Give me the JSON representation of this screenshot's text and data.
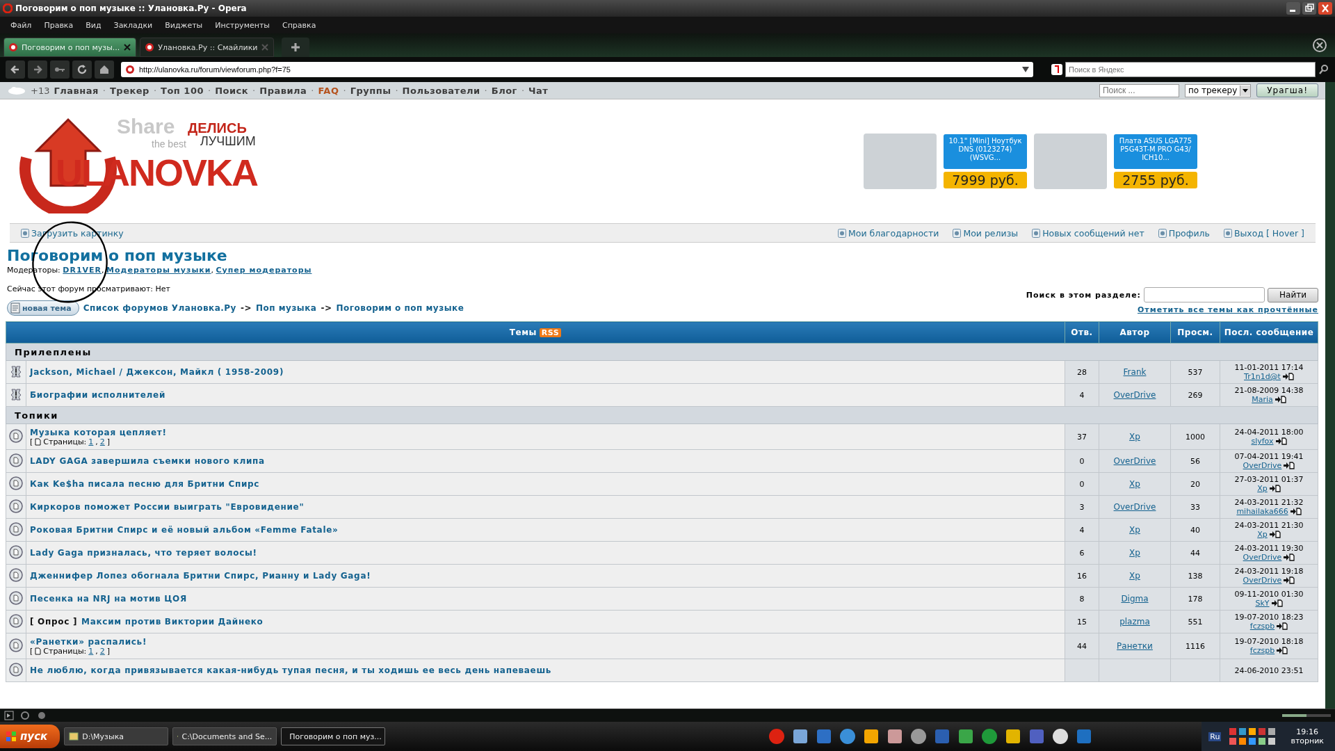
{
  "window": {
    "title": "Поговорим о поп музыке :: Улановка.Ру - Opera"
  },
  "menu": [
    "Файл",
    "Правка",
    "Вид",
    "Закладки",
    "Виджеты",
    "Инструменты",
    "Справка"
  ],
  "tabs": [
    {
      "label": "Поговорим о поп музы...",
      "selected": true
    },
    {
      "label": "Улановка.Ру :: Смайлики",
      "selected": false
    }
  ],
  "address_bar": {
    "url": "http://ulanovka.ru/forum/viewforum.php?f=75"
  },
  "web_search": {
    "placeholder": "Поиск в Яндекс"
  },
  "site_nav": {
    "counter": "+13",
    "separator": "·",
    "links": [
      {
        "label": "Главная",
        "color": "#3c3c3c"
      },
      {
        "label": "Трекер",
        "color": "#3c3c3c"
      },
      {
        "label": "Топ 100",
        "color": "#3c3c3c"
      },
      {
        "label": "Поиск",
        "color": "#3c3c3c"
      },
      {
        "label": "Правила",
        "color": "#3c3c3c"
      },
      {
        "label": "FAQ",
        "color": "#b5521d"
      },
      {
        "label": "Группы",
        "color": "#3c3c3c"
      },
      {
        "label": "Пользователи",
        "color": "#3c3c3c"
      },
      {
        "label": "Блог",
        "color": "#3c3c3c"
      },
      {
        "label": "Чат",
        "color": "#3c3c3c"
      }
    ],
    "search_placeholder": "Поиск ...",
    "scope": "по трекеру",
    "button": "Урагша!"
  },
  "logo": {
    "name": "ULANOVKA",
    "tagline_1": "ДЕЛИСЬ",
    "tagline_2": "ЛУЧШИМ",
    "faded_1": "Share",
    "faded_2": "the best"
  },
  "ads": [
    {
      "title": "10.1\" [Mini] Ноутбук DNS (0123274) (WSVG...",
      "price": "7999 руб."
    },
    {
      "title": "Плата ASUS LGA775 P5G43T-M PRO G43/ ICH10...",
      "price": "2755 руб."
    }
  ],
  "user_bar": {
    "upload": "Загрузить картинку",
    "links": [
      "Мои благодарности",
      "Мои релизы",
      "Новых сообщений нет",
      "Профиль",
      "Выход [ Hover ]"
    ]
  },
  "forum": {
    "title": "Поговорим о поп музыке",
    "moderators_label": "Модераторы:",
    "moderators": [
      "DR1VER",
      "Модераторы музыки",
      "Супер модераторы"
    ],
    "moderators_separator": ",",
    "viewing": "Сейчас этот форум просматривают: Нет",
    "new_topic": "новая тема",
    "breadcrumb": [
      "Список форумов Улановка.Ру",
      "Поп музыка",
      "Поговорим о поп музыке"
    ],
    "breadcrumb_separator": "->",
    "section_search_label": "Поиск в этом разделе:",
    "section_search_button": "Найти",
    "mark_read": "Отметить все темы как прочтённые"
  },
  "table": {
    "columns": [
      "Темы",
      "Отв.",
      "Автор",
      "Просм.",
      "Посл. сообщение"
    ],
    "rss": "RSS",
    "sections": [
      {
        "title": "Прилеплены",
        "rows": [
          {
            "kind": "sticky",
            "title": "Jackson, Michael / Джексон, Майкл ( 1958-2009)",
            "replies": "28",
            "author": "Frank",
            "views": "537",
            "last_date": "11-01-2011 17:14",
            "last_user": "Tr1n1d@t"
          },
          {
            "kind": "sticky",
            "title": "Биографии исполнителей",
            "replies": "4",
            "author": "OverDrive",
            "views": "269",
            "last_date": "21-08-2009 14:38",
            "last_user": "Maria"
          }
        ]
      },
      {
        "title": "Топики",
        "rows": [
          {
            "kind": "topic",
            "title": "Музыка которая цепляет!",
            "pages": {
              "open": "[",
              "label": "Страницы:",
              "links": [
                "1",
                "2"
              ],
              "separator": ",",
              "close": "]"
            },
            "replies": "37",
            "author": "Xp",
            "views": "1000",
            "last_date": "24-04-2011 18:00",
            "last_user": "slyfox"
          },
          {
            "kind": "topic",
            "title": "LADY GAGA завершила съемки нового клипа",
            "replies": "0",
            "author": "OverDrive",
            "views": "56",
            "last_date": "07-04-2011 19:41",
            "last_user": "OverDrive"
          },
          {
            "kind": "topic",
            "title": "Как Ke$ha писала песню для Бритни Спирс",
            "replies": "0",
            "author": "Xp",
            "views": "20",
            "last_date": "27-03-2011 01:37",
            "last_user": "Xp"
          },
          {
            "kind": "topic",
            "title": "Киркоров поможет России выиграть \"Евровидение\"",
            "replies": "3",
            "author": "OverDrive",
            "views": "33",
            "last_date": "24-03-2011 21:32",
            "last_user": "mihailaka666"
          },
          {
            "kind": "topic",
            "title": "Роковая Бритни Спирс и её новый альбом «Femme Fatale»",
            "replies": "4",
            "author": "Xp",
            "views": "40",
            "last_date": "24-03-2011 21:30",
            "last_user": "Xp"
          },
          {
            "kind": "topic",
            "title": "Lady Gaga призналась, что теряет волосы!",
            "replies": "6",
            "author": "Xp",
            "views": "44",
            "last_date": "24-03-2011 19:30",
            "last_user": "OverDrive"
          },
          {
            "kind": "topic",
            "title": "Дженнифер Лопез обогнала Бритни Спирс, Рианну и Lady Gaga!",
            "replies": "16",
            "author": "Xp",
            "views": "138",
            "last_date": "24-03-2011 19:18",
            "last_user": "OverDrive"
          },
          {
            "kind": "topic",
            "title": "Песенка на NRJ на мотив ЦОЯ",
            "replies": "8",
            "author": "Digma",
            "views": "178",
            "last_date": "09-11-2010 01:30",
            "last_user": "SkY"
          },
          {
            "kind": "topic",
            "prefix": "[ Опрос ]",
            "title": "Максим против Виктории Дайнеко",
            "replies": "15",
            "author": "plazma",
            "views": "551",
            "last_date": "19-07-2010 18:23",
            "last_user": "fczspb"
          },
          {
            "kind": "topic",
            "title": "«Ранетки» распались!",
            "pages": {
              "open": "[",
              "label": "Страницы:",
              "links": [
                "1",
                "2"
              ],
              "separator": ",",
              "close": "]"
            },
            "replies": "44",
            "author": "Ранетки",
            "views": "1116",
            "last_date": "19-07-2010 18:18",
            "last_user": "fczspb"
          },
          {
            "kind": "topic",
            "title": "Не люблю, когда привязывается какая-нибудь тупая песня, и ты ходишь ее весь день напеваешь",
            "last_date": "24-06-2010 23:51"
          }
        ]
      }
    ]
  },
  "zoom": {
    "level": 0.5
  },
  "taskbar": {
    "start": "пуск",
    "tasks": [
      {
        "label": "D:\\Музыка",
        "selected": false
      },
      {
        "label": "C:\\Documents and Se...",
        "selected": false
      },
      {
        "label": "Поговорим о поп муз...",
        "selected": true
      }
    ],
    "language": "Ru",
    "time": "19:16",
    "day": "вторник"
  }
}
